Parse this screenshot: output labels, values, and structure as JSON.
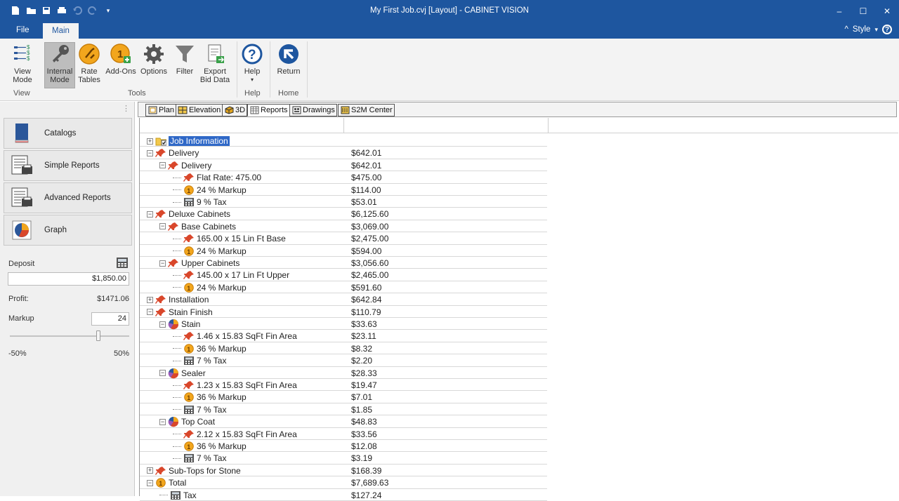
{
  "window": {
    "title": "My First Job.cvj [Layout] - CABINET VISION",
    "controls": [
      "minimize",
      "maximize",
      "close"
    ]
  },
  "ribbon_tabs": [
    {
      "label": "File"
    },
    {
      "label": "Main"
    }
  ],
  "style_menu": {
    "label": "Style"
  },
  "ribbon": {
    "view_mode": "View\nMode",
    "internal_mode": "Internal\nMode",
    "rate_tables": "Rate\nTables",
    "add_ons": "Add-Ons",
    "options": "Options",
    "filter": "Filter",
    "export_bid_data": "Export\nBid Data",
    "help": "Help",
    "return": "Return",
    "groups": {
      "view": "View",
      "tools": "Tools",
      "help": "Help",
      "home": "Home"
    }
  },
  "left_panel": {
    "buttons": [
      "Catalogs",
      "Simple Reports",
      "Advanced Reports",
      "Graph"
    ],
    "deposit_label": "Deposit",
    "deposit_value": "$1,850.00",
    "profit_label": "Profit:",
    "profit_value": "$1471.06",
    "markup_label": "Markup",
    "markup_value": "24",
    "slider_min": "-50%",
    "slider_max": "50%",
    "slider_position": 0.74
  },
  "doc_tabs": [
    {
      "label": "Plan"
    },
    {
      "label": "Elevation"
    },
    {
      "label": "3D"
    },
    {
      "label": "Reports"
    },
    {
      "label": "Drawings"
    },
    {
      "label": "S2M Center"
    }
  ],
  "active_doc_tab": "Reports",
  "report_rows": [
    {
      "level": 0,
      "expander": "+",
      "icon": "folder-icon",
      "name": "Job Information",
      "value": "",
      "selected": true
    },
    {
      "level": 0,
      "expander": "-",
      "icon": "pin-icon",
      "name": "Delivery",
      "value": "$642.01"
    },
    {
      "level": 1,
      "expander": "-",
      "icon": "pin-icon",
      "name": "Delivery",
      "value": "$642.01"
    },
    {
      "level": 2,
      "expander": "",
      "icon": "pin-icon",
      "name": "Flat Rate: 475.00",
      "value": "$475.00"
    },
    {
      "level": 2,
      "expander": "",
      "icon": "coin-icon",
      "name": "24 % Markup",
      "value": "$114.00"
    },
    {
      "level": 2,
      "expander": "",
      "icon": "calculator-icon",
      "name": "9 % Tax",
      "value": "$53.01"
    },
    {
      "level": 0,
      "expander": "-",
      "icon": "pin-icon",
      "name": "Deluxe Cabinets",
      "value": "$6,125.60"
    },
    {
      "level": 1,
      "expander": "-",
      "icon": "pin-icon",
      "name": "Base Cabinets",
      "value": "$3,069.00"
    },
    {
      "level": 2,
      "expander": "",
      "icon": "pin-icon",
      "name": "165.00 x 15 Lin Ft Base",
      "value": "$2,475.00"
    },
    {
      "level": 2,
      "expander": "",
      "icon": "coin-icon",
      "name": "24 % Markup",
      "value": "$594.00"
    },
    {
      "level": 1,
      "expander": "-",
      "icon": "pin-icon",
      "name": "Upper Cabinets",
      "value": "$3,056.60"
    },
    {
      "level": 2,
      "expander": "",
      "icon": "pin-icon",
      "name": "145.00 x 17 Lin Ft Upper",
      "value": "$2,465.00"
    },
    {
      "level": 2,
      "expander": "",
      "icon": "coin-icon",
      "name": "24 % Markup",
      "value": "$591.60"
    },
    {
      "level": 0,
      "expander": "+",
      "icon": "pin-icon",
      "name": "Installation",
      "value": "$642.84"
    },
    {
      "level": 0,
      "expander": "-",
      "icon": "pin-icon",
      "name": "Stain Finish",
      "value": "$110.79"
    },
    {
      "level": 1,
      "expander": "-",
      "icon": "color-wheel-icon",
      "name": "Stain",
      "value": "$33.63"
    },
    {
      "level": 2,
      "expander": "",
      "icon": "pin-icon",
      "name": "1.46 x 15.83 SqFt Fin Area",
      "value": "$23.11"
    },
    {
      "level": 2,
      "expander": "",
      "icon": "coin-icon",
      "name": "36 % Markup",
      "value": "$8.32"
    },
    {
      "level": 2,
      "expander": "",
      "icon": "calculator-icon",
      "name": "7 % Tax",
      "value": "$2.20"
    },
    {
      "level": 1,
      "expander": "-",
      "icon": "color-wheel-icon",
      "name": "Sealer",
      "value": "$28.33"
    },
    {
      "level": 2,
      "expander": "",
      "icon": "pin-icon",
      "name": "1.23 x 15.83 SqFt Fin Area",
      "value": "$19.47"
    },
    {
      "level": 2,
      "expander": "",
      "icon": "coin-icon",
      "name": "36 % Markup",
      "value": "$7.01"
    },
    {
      "level": 2,
      "expander": "",
      "icon": "calculator-icon",
      "name": "7 % Tax",
      "value": "$1.85"
    },
    {
      "level": 1,
      "expander": "-",
      "icon": "color-wheel-icon",
      "name": "Top Coat",
      "value": "$48.83"
    },
    {
      "level": 2,
      "expander": "",
      "icon": "pin-icon",
      "name": "2.12 x 15.83 SqFt Fin Area",
      "value": "$33.56"
    },
    {
      "level": 2,
      "expander": "",
      "icon": "coin-icon",
      "name": "36 % Markup",
      "value": "$12.08"
    },
    {
      "level": 2,
      "expander": "",
      "icon": "calculator-icon",
      "name": "7 % Tax",
      "value": "$3.19"
    },
    {
      "level": 0,
      "expander": "+",
      "icon": "pin-icon",
      "name": "Sub-Tops for Stone",
      "value": "$168.39"
    },
    {
      "level": 0,
      "expander": "-",
      "icon": "coin-icon",
      "name": "Total",
      "value": "$7,689.63"
    },
    {
      "level": 1,
      "expander": "",
      "icon": "calculator-icon",
      "name": "Tax",
      "value": "$127.24"
    }
  ],
  "colors": {
    "title_bar": "#1e569f",
    "ribbon_bg": "#f3f3f3",
    "selection": "#2f68c7",
    "pin": "#d9472b",
    "coin": "#f2a61d"
  }
}
